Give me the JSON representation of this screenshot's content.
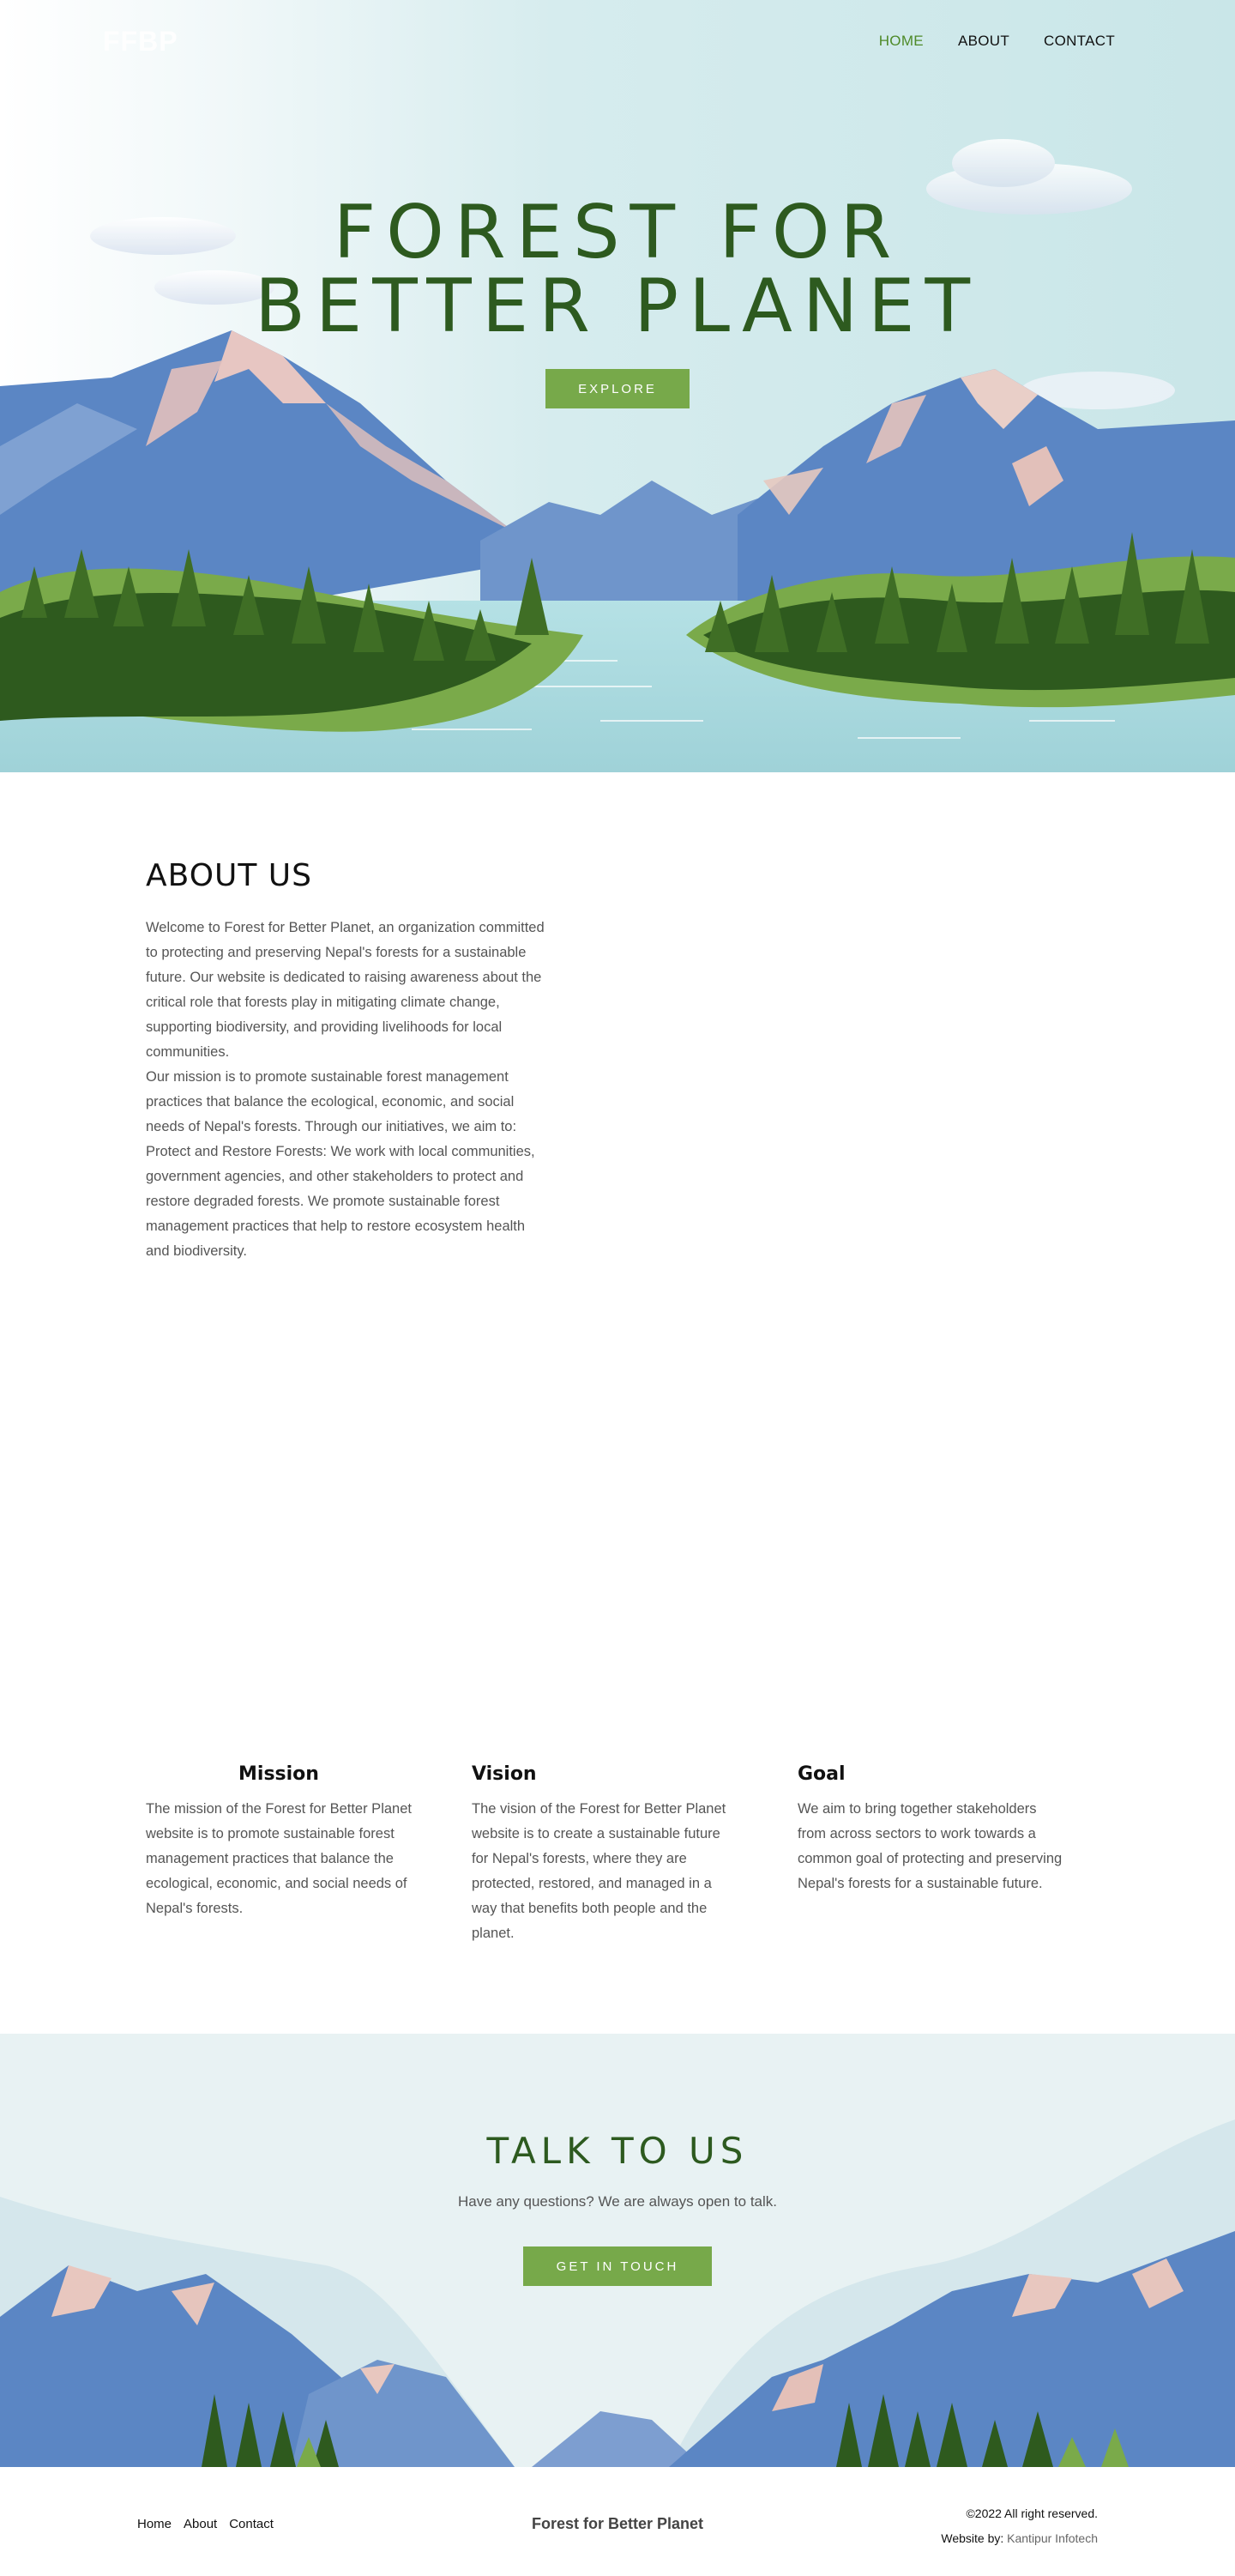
{
  "header": {
    "logo": "FFBP",
    "nav": [
      {
        "label": "HOME",
        "active": true
      },
      {
        "label": "ABOUT",
        "active": false
      },
      {
        "label": "CONTACT",
        "active": false
      }
    ]
  },
  "hero": {
    "title": "FOREST FOR BETTER PLANET",
    "button": "EXPLORE"
  },
  "about": {
    "heading": "ABOUT US",
    "paragraphs": [
      "Welcome to Forest for Better Planet, an organization committed to protecting and preserving Nepal's forests for a sustainable future. Our website is dedicated to raising awareness about the critical role that forests play in mitigating climate change, supporting biodiversity, and providing livelihoods for local communities.",
      "Our mission is to promote sustainable forest management practices that balance the ecological, economic, and social needs of Nepal's forests. Through our initiatives, we aim to: Protect and Restore Forests: We work with local communities, government agencies, and other stakeholders to protect and restore degraded forests. We promote sustainable forest management practices that help to restore ecosystem health and biodiversity."
    ]
  },
  "mvg": {
    "mission": {
      "title": "Mission",
      "text": "The mission of the Forest for Better Planet website is to promote sustainable forest management practices that balance the ecological, economic, and social needs of Nepal's forests."
    },
    "vision": {
      "title": "Vision",
      "text": "The vision of the Forest for Better Planet website is to create a sustainable future for Nepal's forests, where they are protected, restored, and managed in a way that benefits both people and the planet."
    },
    "goal": {
      "title": "Goal",
      "text": "We aim to bring together stakeholders from across sectors to work towards a common goal of protecting and preserving Nepal's forests for a sustainable future."
    }
  },
  "contact": {
    "heading": "TALK TO US",
    "subtitle": "Have any questions? We are always open to talk.",
    "button": "GET IN TOUCH"
  },
  "footer": {
    "links": [
      "Home",
      "About",
      "Contact"
    ],
    "brand": "Forest for Better Planet",
    "copyright": "©2022  All right reserved.",
    "credit_label": "Website by:",
    "credit_name": "Kantipur Infotech"
  },
  "colors": {
    "brand_green": "#77a94a",
    "dark_green": "#2d5a1f",
    "nav_active": "#4e8a28",
    "sky": "#c9e6e8",
    "mountain_blue": "#5b86c4",
    "lake": "#a9dbe0"
  }
}
